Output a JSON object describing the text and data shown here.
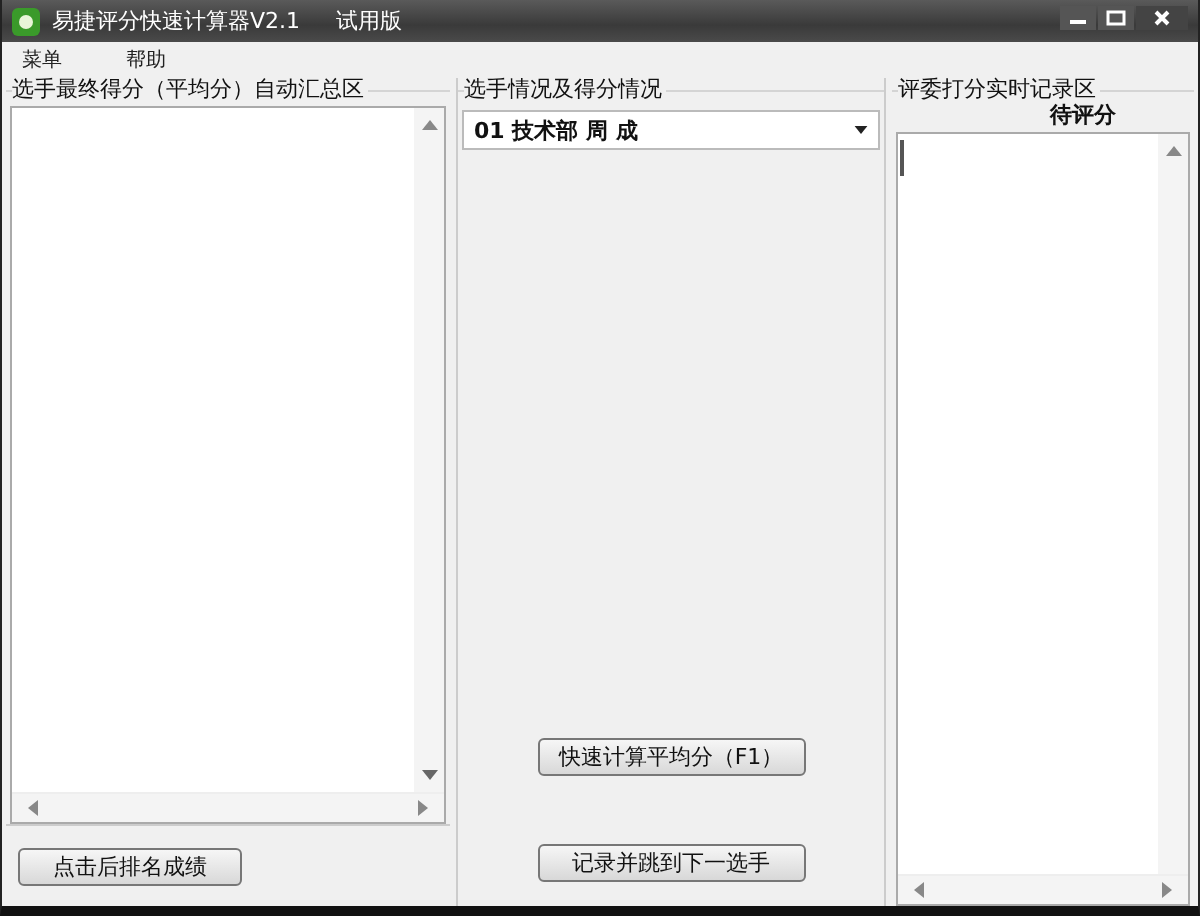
{
  "window": {
    "title": "易捷评分快速计算器V2.1",
    "edition": "试用版"
  },
  "menu": [
    "菜单",
    "帮助"
  ],
  "summary_panel": {
    "title": "选手最终得分（平均分）自动汇总区",
    "button": "点击后排名成绩"
  },
  "contestant_panel": {
    "title": "选手情况及得分情况",
    "contestant": "01 技术部 周 成",
    "buttons": [
      "快速计算平均分（F1）",
      "记录并跳到下一选手"
    ]
  },
  "judge_panel": {
    "title": "评委打分实时记录区",
    "status": "待评分"
  }
}
